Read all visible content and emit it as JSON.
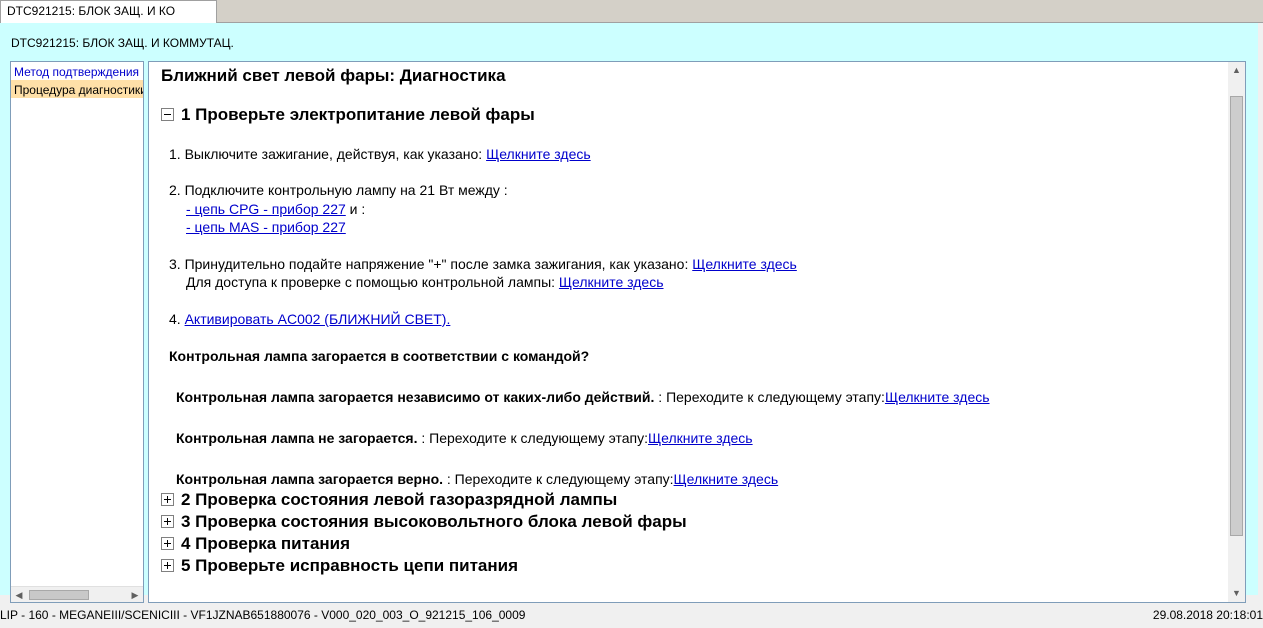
{
  "tab": {
    "label": "DTC921215: БЛОК ЗАЩ. И КО"
  },
  "frame": {
    "title": "DTC921215: БЛОК ЗАЩ. И КОММУТАЦ."
  },
  "sidebar": {
    "items": [
      {
        "label": "Метод подтверждения"
      },
      {
        "label": "Процедура диагностики"
      }
    ]
  },
  "content": {
    "title": "Ближний свет левой фары: Диагностика",
    "step1": {
      "title": "1 Проверьте электропитание левой фары",
      "items": {
        "i1_text": "1. Выключите зажигание, действуя, как указано: ",
        "i1_link": "Щелкните здесь",
        "i2_text": "2. Подключите контрольную лампу на 21 Вт между :",
        "i2_link1": "- цепь CPG - прибор 227",
        "i2_mid": " и  :",
        "i2_link2": "- цепь MAS - прибор 227",
        "i3_text": "3. Принудительно подайте напряжение \"+\" после замка зажигания, как указано: ",
        "i3_link": "Щелкните здесь",
        "i3b_text": "Для доступа к проверке с помощью контрольной лампы: ",
        "i3b_link": "Щелкните здесь",
        "i4_num": "4. ",
        "i4_link": "Активировать AC002 (БЛИЖНИЙ СВЕТ)."
      },
      "question": "Контрольная лампа загорается в соответствии с командой?",
      "answers": [
        {
          "bold": "Контрольная лампа загорается независимо от каких-либо действий.",
          "text": " : Переходите к следующему этапу:",
          "link": "Щелкните здесь"
        },
        {
          "bold": "Контрольная лампа не загорается.",
          "text": " : Переходите к следующему этапу:",
          "link": "Щелкните здесь"
        },
        {
          "bold": "Контрольная лампа загорается верно.",
          "text": " : Переходите к следующему этапу:",
          "link": "Щелкните здесь"
        }
      ]
    },
    "collapsed_steps": [
      {
        "title": "2 Проверка состояния левой газоразрядной лампы"
      },
      {
        "title": "3 Проверка состояния высоковольтного блока левой фары"
      },
      {
        "title": "4 Проверка питания"
      },
      {
        "title": "5 Проверьте исправность цепи питания"
      }
    ]
  },
  "status": {
    "left": "LIP - 160 - MEGANEIII/SCENICIII - VF1JZNAB651880076 - V000_020_003_O_921215_106_0009",
    "right": "29.08.2018 20:18:01"
  }
}
